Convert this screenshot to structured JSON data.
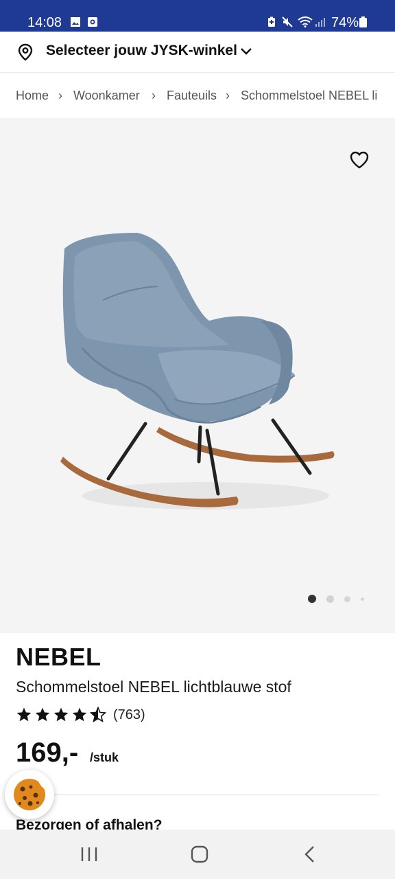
{
  "status_bar": {
    "time": "14:08",
    "battery": "74%",
    "icons": [
      "gallery-icon",
      "record-icon",
      "battery-saver-icon",
      "mute-icon",
      "wifi-icon",
      "signal-icon",
      "battery-icon"
    ]
  },
  "store_selector": {
    "label": "Selecteer jouw JYSK-winkel",
    "icon": "location-pin-icon"
  },
  "breadcrumb": {
    "items": [
      "Home",
      "Woonkamer",
      "Fauteuils",
      "Schommelstoel NEBEL li"
    ],
    "separator": "›"
  },
  "gallery": {
    "image_count": 4,
    "active_index": 0,
    "background": "#f4f4f4"
  },
  "product": {
    "brand": "NEBEL",
    "name": "Schommelstoel NEBEL lichtblauwe stof",
    "rating_value": 4.5,
    "rating_max": 5,
    "review_count": "(763)",
    "price": "169,-",
    "unit": "/stuk"
  },
  "section": {
    "delivery_heading": "Bezorgen of afhalen?"
  },
  "colors": {
    "status_bar": "#1f3a93",
    "chair_fabric": "#7d95ad",
    "rocker_wood": "#a86a3c"
  }
}
